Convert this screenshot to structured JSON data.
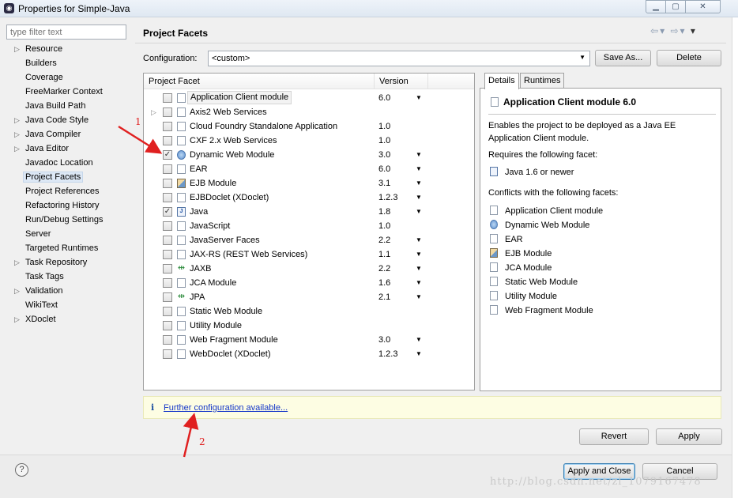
{
  "window": {
    "title": "Properties for Simple-Java",
    "min_icon": "minimize-icon",
    "max_icon": "maximize-icon",
    "close_icon": "close-icon"
  },
  "sidebar": {
    "filter_placeholder": "type filter text",
    "items": [
      {
        "label": "Resource",
        "expandable": true
      },
      {
        "label": "Builders",
        "expandable": false
      },
      {
        "label": "Coverage",
        "expandable": false
      },
      {
        "label": "FreeMarker Context",
        "expandable": false
      },
      {
        "label": "Java Build Path",
        "expandable": false
      },
      {
        "label": "Java Code Style",
        "expandable": true
      },
      {
        "label": "Java Compiler",
        "expandable": true
      },
      {
        "label": "Java Editor",
        "expandable": true
      },
      {
        "label": "Javadoc Location",
        "expandable": false
      },
      {
        "label": "Project Facets",
        "expandable": false,
        "selected": true
      },
      {
        "label": "Project References",
        "expandable": false
      },
      {
        "label": "Refactoring History",
        "expandable": false
      },
      {
        "label": "Run/Debug Settings",
        "expandable": false
      },
      {
        "label": "Server",
        "expandable": false
      },
      {
        "label": "Targeted Runtimes",
        "expandable": false
      },
      {
        "label": "Task Repository",
        "expandable": true
      },
      {
        "label": "Task Tags",
        "expandable": false
      },
      {
        "label": "Validation",
        "expandable": true
      },
      {
        "label": "WikiText",
        "expandable": false
      },
      {
        "label": "XDoclet",
        "expandable": true
      }
    ]
  },
  "main": {
    "title": "Project Facets",
    "configuration_label": "Configuration:",
    "configuration_value": "<custom>",
    "save_as_label": "Save As...",
    "delete_label": "Delete",
    "table": {
      "col_facet": "Project Facet",
      "col_version": "Version",
      "rows": [
        {
          "name": "Application Client module",
          "version": "6.0",
          "checked": false,
          "dropdown": true,
          "icon": "page-icon",
          "highlight": true
        },
        {
          "name": "Axis2 Web Services",
          "version": "",
          "checked": false,
          "dropdown": false,
          "icon": "page-icon",
          "expandable": true
        },
        {
          "name": "Cloud Foundry Standalone Application",
          "version": "1.0",
          "checked": false,
          "dropdown": false,
          "icon": "page-icon"
        },
        {
          "name": "CXF 2.x Web Services",
          "version": "1.0",
          "checked": false,
          "dropdown": false,
          "icon": "page-icon"
        },
        {
          "name": "Dynamic Web Module",
          "version": "3.0",
          "checked": true,
          "dropdown": true,
          "icon": "globe-icon"
        },
        {
          "name": "EAR",
          "version": "6.0",
          "checked": false,
          "dropdown": true,
          "icon": "page-icon"
        },
        {
          "name": "EJB Module",
          "version": "3.1",
          "checked": false,
          "dropdown": true,
          "icon": "bean-icon"
        },
        {
          "name": "EJBDoclet (XDoclet)",
          "version": "1.2.3",
          "checked": false,
          "dropdown": true,
          "icon": "page-icon"
        },
        {
          "name": "Java",
          "version": "1.8",
          "checked": true,
          "dropdown": true,
          "icon": "java-icon"
        },
        {
          "name": "JavaScript",
          "version": "1.0",
          "checked": false,
          "dropdown": false,
          "icon": "page-icon"
        },
        {
          "name": "JavaServer Faces",
          "version": "2.2",
          "checked": false,
          "dropdown": true,
          "icon": "page-icon"
        },
        {
          "name": "JAX-RS (REST Web Services)",
          "version": "1.1",
          "checked": false,
          "dropdown": true,
          "icon": "page-icon"
        },
        {
          "name": "JAXB",
          "version": "2.2",
          "checked": false,
          "dropdown": true,
          "icon": "plug-icon"
        },
        {
          "name": "JCA Module",
          "version": "1.6",
          "checked": false,
          "dropdown": true,
          "icon": "page-icon"
        },
        {
          "name": "JPA",
          "version": "2.1",
          "checked": false,
          "dropdown": true,
          "icon": "plug-icon"
        },
        {
          "name": "Static Web Module",
          "version": "",
          "checked": false,
          "dropdown": false,
          "icon": "page-icon"
        },
        {
          "name": "Utility Module",
          "version": "",
          "checked": false,
          "dropdown": false,
          "icon": "page-icon"
        },
        {
          "name": "Web Fragment Module",
          "version": "3.0",
          "checked": false,
          "dropdown": true,
          "icon": "page-icon"
        },
        {
          "name": "WebDoclet (XDoclet)",
          "version": "1.2.3",
          "checked": false,
          "dropdown": true,
          "icon": "page-icon"
        }
      ]
    }
  },
  "details": {
    "tab_details": "Details",
    "tab_runtimes": "Runtimes",
    "title": "Application Client module 6.0",
    "description": "Enables the project to be deployed as a Java EE Application Client module.",
    "requires_label": "Requires the following facet:",
    "requires": [
      {
        "name": "Java 1.6 or newer",
        "icon": "java-icon"
      }
    ],
    "conflicts_label": "Conflicts with the following facets:",
    "conflicts": [
      {
        "name": "Application Client module",
        "icon": "page-icon"
      },
      {
        "name": "Dynamic Web Module",
        "icon": "globe-icon"
      },
      {
        "name": "EAR",
        "icon": "page-icon"
      },
      {
        "name": "EJB Module",
        "icon": "bean-icon"
      },
      {
        "name": "JCA Module",
        "icon": "page-icon"
      },
      {
        "name": "Static Web Module",
        "icon": "page-icon"
      },
      {
        "name": "Utility Module",
        "icon": "page-icon"
      },
      {
        "name": "Web Fragment Module",
        "icon": "page-icon"
      }
    ]
  },
  "info": {
    "link": "Further configuration available..."
  },
  "buttons": {
    "revert": "Revert",
    "apply": "Apply",
    "apply_close": "Apply and Close",
    "cancel": "Cancel"
  },
  "annotations": {
    "one": "1",
    "two": "2"
  },
  "watermark": "http://blog.csdn.net/zl_1079167478",
  "colors": {
    "annotation_red": "#e02020",
    "link_blue": "#1537c9",
    "info_bg": "#fdfde3",
    "selection_bg": "#dde8f5"
  }
}
